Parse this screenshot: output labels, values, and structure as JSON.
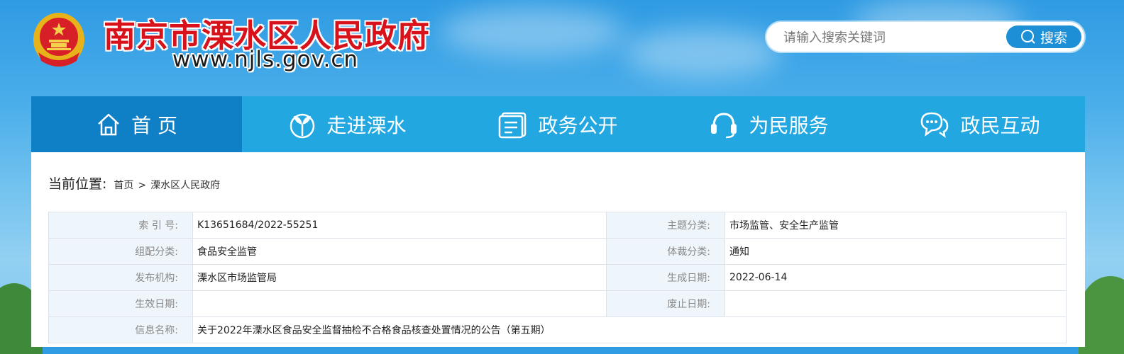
{
  "header": {
    "site_title": "南京市溧水区人民政府",
    "site_url": "www.njls.gov.cn"
  },
  "search": {
    "placeholder": "请输入搜索关键词",
    "button_label": "搜索"
  },
  "nav": {
    "items": [
      {
        "label": "首 页",
        "icon": "home-icon"
      },
      {
        "label": "走进溧水",
        "icon": "sprout-icon"
      },
      {
        "label": "政务公开",
        "icon": "document-icon"
      },
      {
        "label": "为民服务",
        "icon": "headset-icon"
      },
      {
        "label": "政民互动",
        "icon": "chat-icon"
      }
    ]
  },
  "breadcrumb": {
    "label": "当前位置:",
    "items": [
      "首页",
      "溧水区人民政府"
    ],
    "separator": ">"
  },
  "info_table": {
    "rows": [
      {
        "l1": "索 引 号:",
        "v1": "K13651684/2022-55251",
        "l2": "主题分类:",
        "v2": "市场监管、安全生产监管"
      },
      {
        "l1": "组配分类:",
        "v1": "食品安全监管",
        "l2": "体裁分类:",
        "v2": "通知"
      },
      {
        "l1": "发布机构:",
        "v1": "溧水区市场监管局",
        "l2": "生成日期:",
        "v2": "2022-06-14"
      },
      {
        "l1": "生效日期:",
        "v1": "",
        "l2": "废止日期:",
        "v2": ""
      }
    ],
    "title_row": {
      "label": "信息名称:",
      "value": "关于2022年溧水区食品安全监督抽检不合格食品核查处置情况的公告（第五期）"
    }
  },
  "colors": {
    "nav_bg": "#22a7e0",
    "nav_active": "#0f7fc6",
    "title_red": "#d8121b",
    "label_bg": "#eef6fc"
  }
}
